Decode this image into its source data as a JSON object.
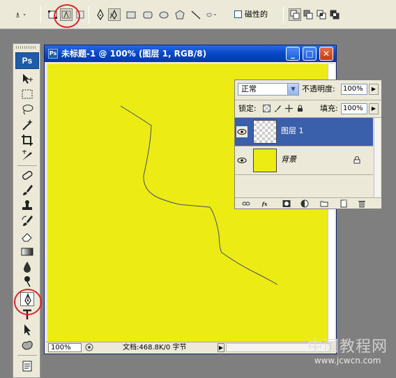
{
  "options_bar": {
    "magnetic_label": "磁性的",
    "tool_icons": [
      "pen-preset-icon",
      "shape-layers-icon",
      "paths-icon",
      "fill-pixels-icon",
      "pen-icon",
      "freeform-pen-icon",
      "rectangle-icon",
      "rounded-rectangle-icon",
      "ellipse-icon",
      "polygon-icon",
      "line-icon",
      "custom-shape-icon",
      "add-area-icon",
      "subtract-area-icon",
      "intersect-area-icon",
      "exclude-area-icon"
    ]
  },
  "toolbox": {
    "logo": "Ps"
  },
  "document": {
    "title": "未标题-1 @ 100% (图层 1, RGB/8)",
    "minimize": "_",
    "maximize": "□",
    "close": "✕",
    "canvas_color": "#ecec14",
    "zoom": "100%",
    "doc_info": "文档:468.8K/0 字节"
  },
  "layers_panel": {
    "blend_mode": "正常",
    "opacity_label": "不透明度:",
    "opacity_value": "100%",
    "lock_label": "锁定:",
    "fill_label": "填充:",
    "fill_value": "100%",
    "layers": [
      {
        "name": "图层 1",
        "selected": true,
        "thumb": "transparent"
      },
      {
        "name": "背景",
        "selected": false,
        "thumb": "#ecec14"
      }
    ]
  },
  "watermark": {
    "line1": "中国教程网",
    "line2": "www.jcwcn.com"
  },
  "colors": {
    "selection_blue": "#3a5fab",
    "highlight_red": "#d8242a",
    "title_blue": "#0a49c9"
  }
}
